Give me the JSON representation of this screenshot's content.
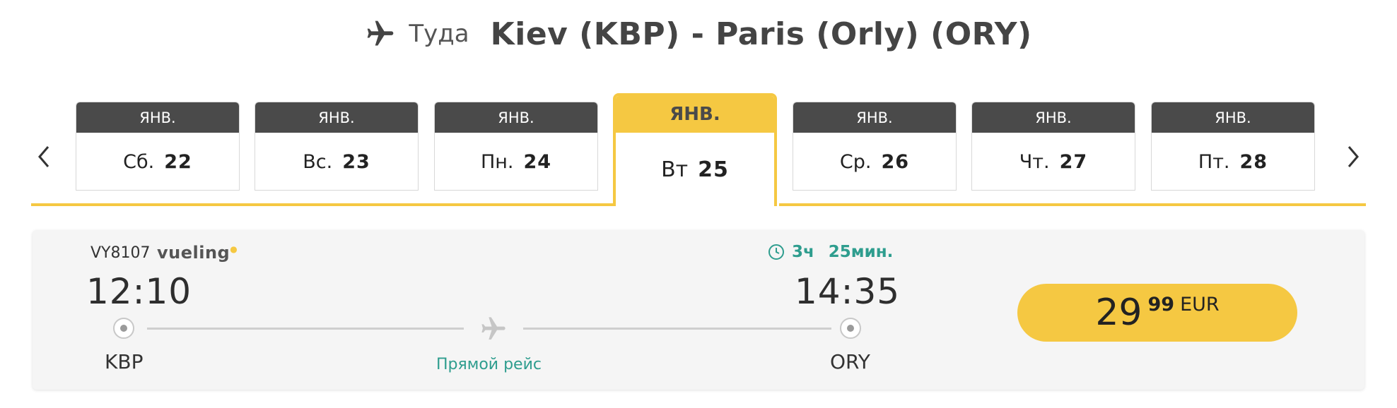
{
  "header": {
    "direction_label": "Туда",
    "route": "Kiev (KBP) - Paris (Orly) (ORY)"
  },
  "date_strip": {
    "days": [
      {
        "month": "ЯНВ.",
        "weekday": "Сб.",
        "day": "22"
      },
      {
        "month": "ЯНВ.",
        "weekday": "Вс.",
        "day": "23"
      },
      {
        "month": "ЯНВ.",
        "weekday": "Пн.",
        "day": "24"
      },
      {
        "month": "ЯНВ.",
        "weekday": "Вт",
        "day": "25"
      },
      {
        "month": "ЯНВ.",
        "weekday": "Ср.",
        "day": "26"
      },
      {
        "month": "ЯНВ.",
        "weekday": "Чт.",
        "day": "27"
      },
      {
        "month": "ЯНВ.",
        "weekday": "Пт.",
        "day": "28"
      }
    ],
    "selected_index": 3
  },
  "flight": {
    "flight_number": "VY8107",
    "airline": "vueling",
    "duration_hours": "3ч",
    "duration_minutes": "25мин.",
    "departure_time": "12:10",
    "arrival_time": "14:35",
    "departure_code": "KBP",
    "arrival_code": "ORY",
    "stop_type": "Прямой рейс",
    "price_integer": "29",
    "price_cents": "99",
    "price_currency": "EUR"
  },
  "colors": {
    "accent": "#f5c842",
    "month_bar": "#4a4a4a",
    "teal": "#2e9d8e"
  }
}
